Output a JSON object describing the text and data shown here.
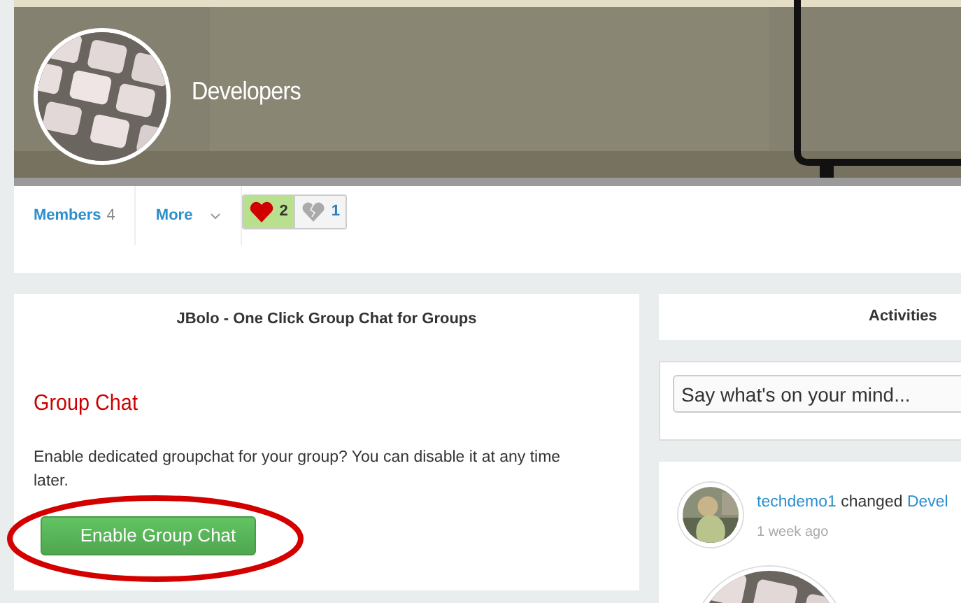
{
  "group": {
    "name": "Developers"
  },
  "tabs": [
    {
      "label": "Members",
      "count": "4",
      "kind": "count"
    },
    {
      "label": "More",
      "kind": "menu"
    }
  ],
  "reactions": [
    {
      "kind": "like",
      "count": "2",
      "selected": true
    },
    {
      "kind": "dislike",
      "count": "1",
      "selected": false
    }
  ],
  "plugin_panel": {
    "title": "JBolo - One Click Group Chat for Groups",
    "heading": "Group Chat",
    "description": "Enable dedicated groupchat for your group? You can disable it at any time later.",
    "button": "Enable Group Chat",
    "highlighted": true
  },
  "activities": {
    "title": "Activities",
    "status_field": {
      "placeholder": "Say what's on your mind..."
    },
    "items": [
      {
        "actor": "techdemo1",
        "verb": "changed",
        "target": "Devel",
        "time": "1 week ago"
      }
    ]
  }
}
